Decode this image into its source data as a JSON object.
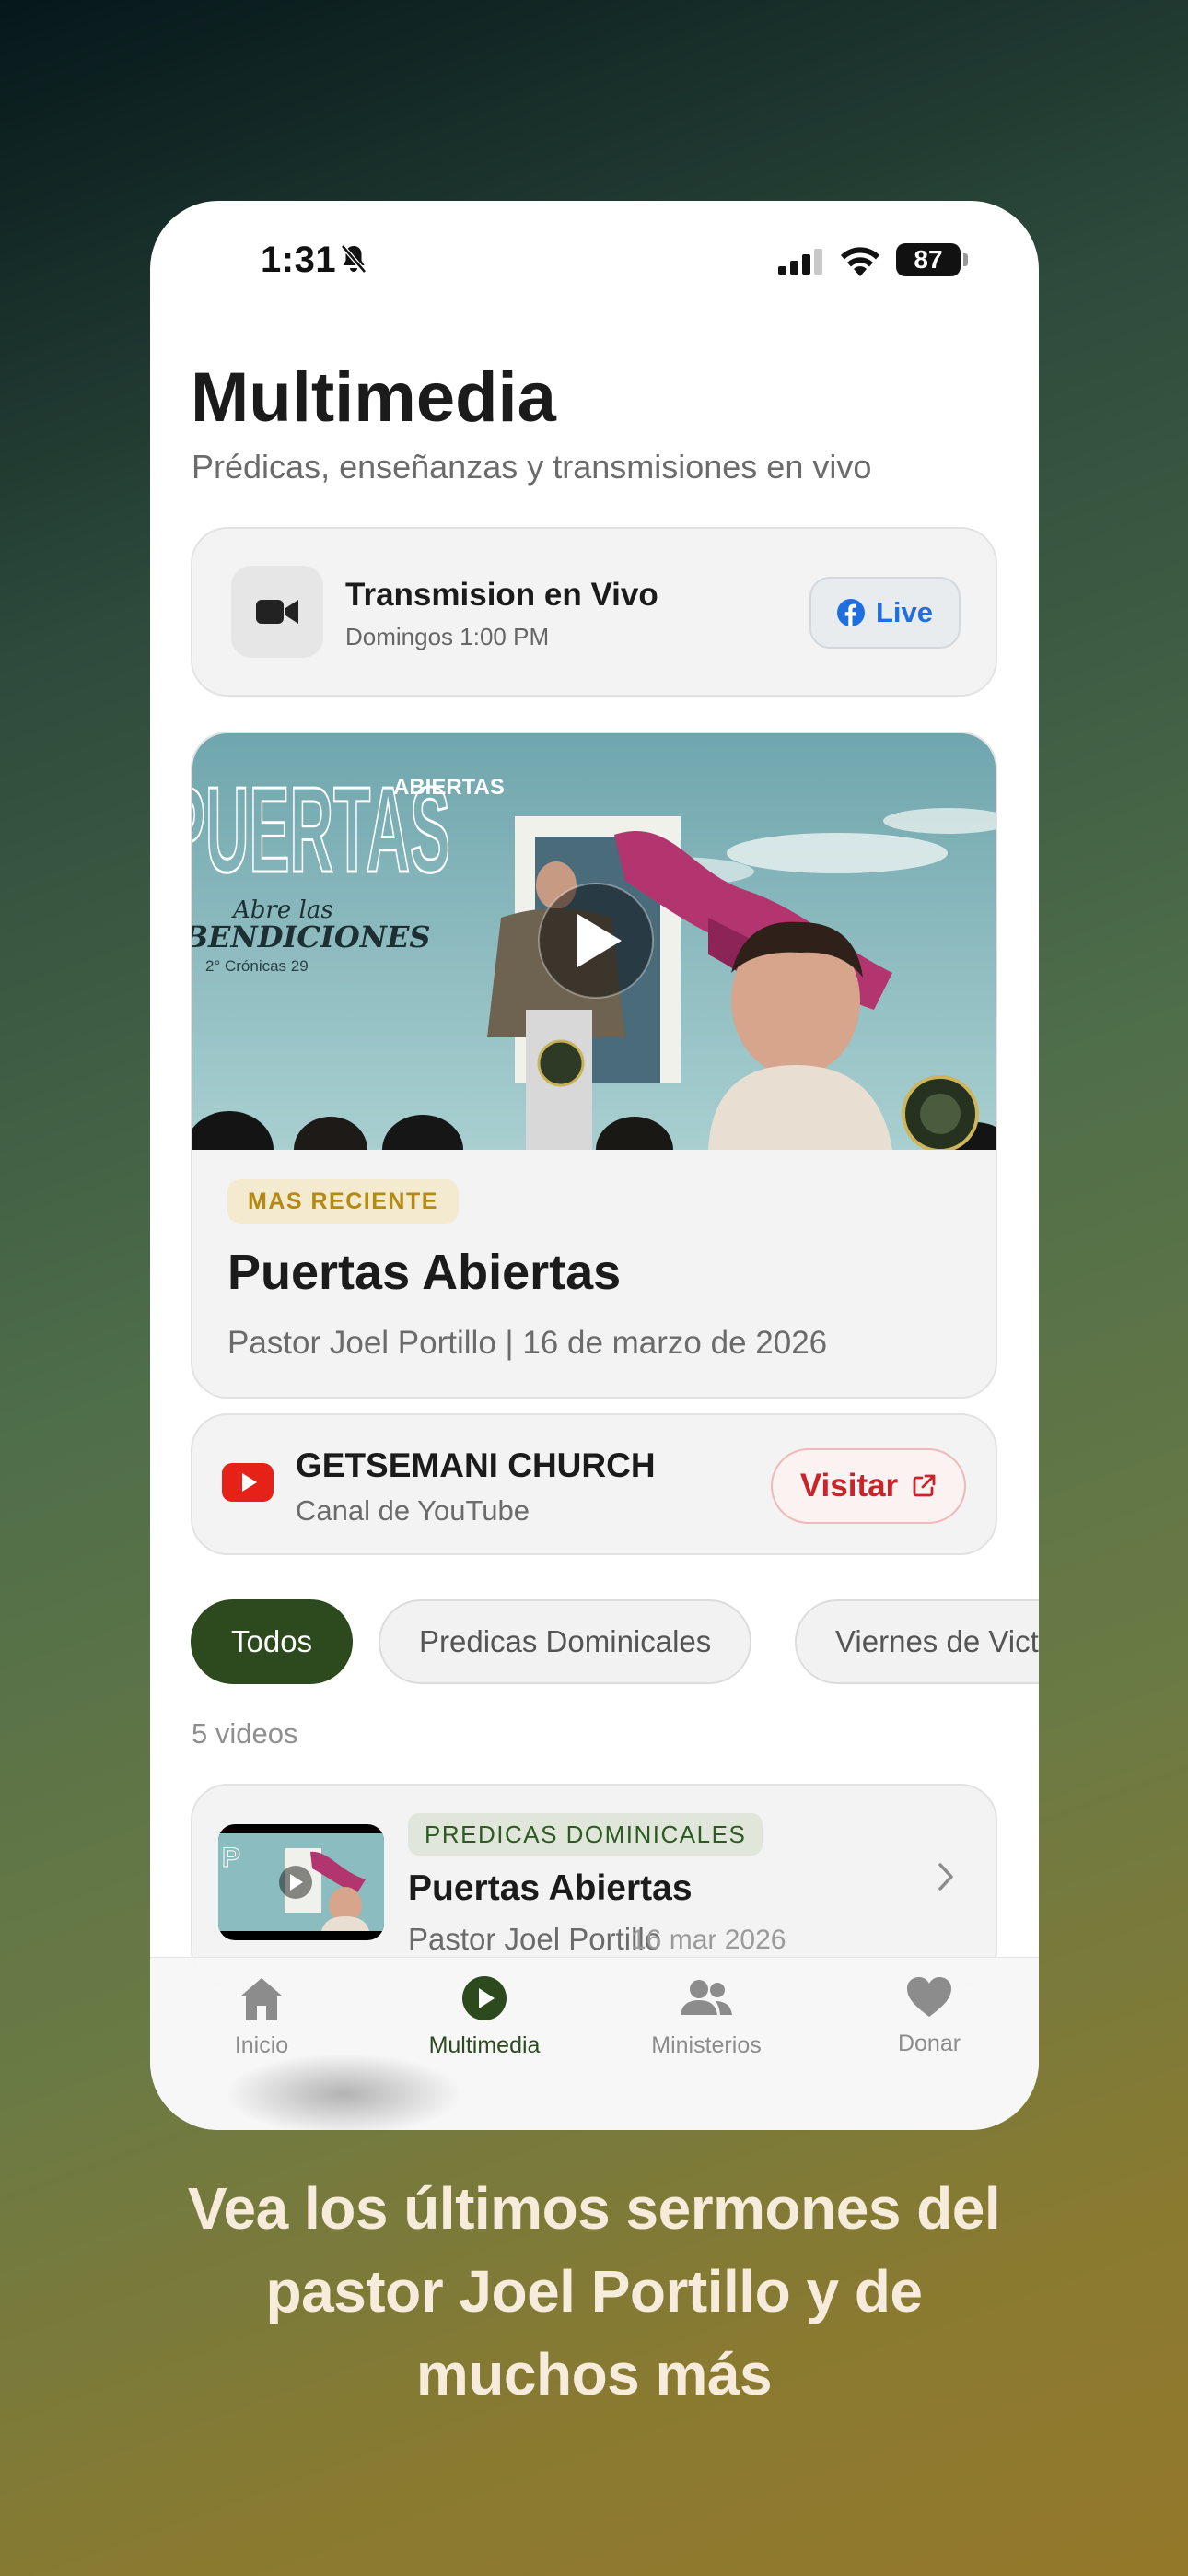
{
  "status_bar": {
    "time": "1:31",
    "battery": "87"
  },
  "header": {
    "title": "Multimedia",
    "subtitle": "Prédicas, enseñanzas y transmisiones en vivo"
  },
  "live": {
    "title": "Transmision en Vivo",
    "schedule": "Domingos 1:00 PM",
    "button_label": "Live"
  },
  "featured": {
    "badge": "MAS RECIENTE",
    "title": "Puertas Abiertas",
    "meta": "Pastor Joel Portillo | 16 de marzo de 2026",
    "thumbnail": {
      "big_text": "PUERTAS",
      "small_text": "ABIERTAS",
      "script_line1": "Abre las",
      "script_line2": "BENDICIONES",
      "verse": "2° Crónicas 29"
    }
  },
  "youtube": {
    "title": "GETSEMANI CHURCH",
    "subtitle": "Canal de YouTube",
    "button_label": "Visitar"
  },
  "filters": {
    "chips": [
      {
        "label": "Todos",
        "active": true
      },
      {
        "label": "Predicas Dominicales",
        "active": false
      },
      {
        "label": "Viernes de Victoria",
        "active": false
      }
    ]
  },
  "video_count": "5 videos",
  "videos": [
    {
      "category": "PREDICAS DOMINICALES",
      "title": "Puertas Abiertas",
      "author": "Pastor Joel Portillo",
      "date": "16 mar 2026"
    }
  ],
  "tabbar": {
    "tabs": [
      {
        "label": "Inicio",
        "icon": "home-icon",
        "active": false
      },
      {
        "label": "Multimedia",
        "icon": "play-circle-icon",
        "active": true
      },
      {
        "label": "Ministerios",
        "icon": "people-icon",
        "active": false
      },
      {
        "label": "Donar",
        "icon": "heart-icon",
        "active": false
      }
    ]
  },
  "caption": {
    "line1": "Vea los últimos sermones del",
    "line2": "pastor Joel Portillo y de",
    "line3": "muchos más"
  },
  "colors": {
    "accent_green": "#2c4a1e",
    "badge_gold": "#b58a14",
    "youtube_red": "#e62117",
    "facebook_blue": "#1f6fe0"
  }
}
